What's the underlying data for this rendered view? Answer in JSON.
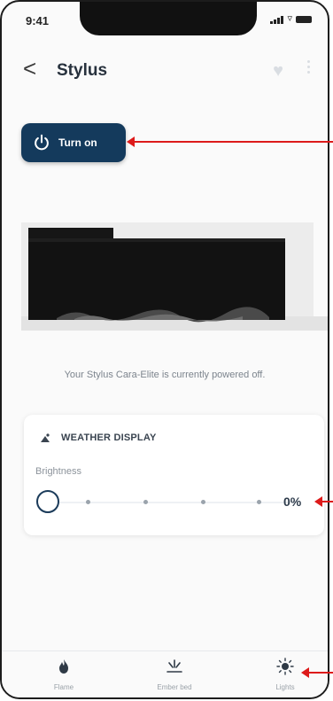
{
  "status_bar": {
    "time": "9:41"
  },
  "header": {
    "back_glyph": "<",
    "title": "Stylus",
    "favorite_icon": "heart-icon",
    "menu_icon": "more-vertical-icon"
  },
  "power": {
    "label": "Turn on",
    "icon": "power-icon",
    "color": "#143a5c"
  },
  "status_message": "Your Stylus Cara-Elite is currently powered off.",
  "weather_card": {
    "title": "WEATHER DISPLAY",
    "icon": "weather-icon",
    "brightness_label": "Brightness",
    "brightness_value": 0,
    "brightness_text": "0%"
  },
  "tabs": [
    {
      "label": "Flame",
      "icon": "flame-icon"
    },
    {
      "label": "Ember bed",
      "icon": "ember-bed-icon"
    },
    {
      "label": "Lights",
      "icon": "sun-icon"
    }
  ],
  "annotation_color": "#dd1a1a"
}
